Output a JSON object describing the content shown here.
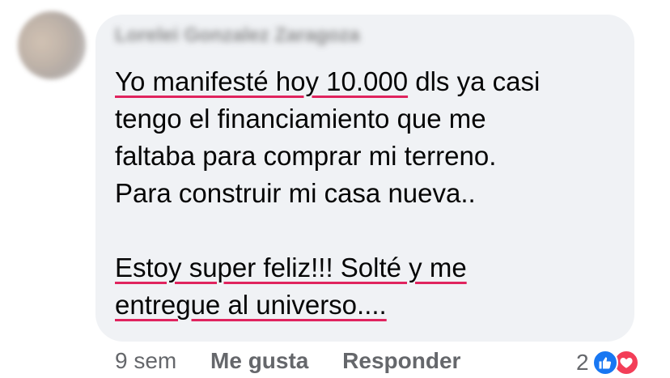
{
  "comment": {
    "author": "Lorelei Gonzalez Zaragoza",
    "lines": [
      {
        "before": "",
        "underlined": "Yo manifesté hoy 10.000",
        "after": " dls ya casi"
      },
      {
        "text": "tengo el financiamiento que me"
      },
      {
        "text": "faltaba para comprar mi terreno."
      },
      {
        "text": "Para construir mi casa nueva.."
      },
      {
        "text": ""
      },
      {
        "underlined": "Estoy super feliz!!! Solté y me"
      },
      {
        "underlined": "entregue al universo...."
      }
    ]
  },
  "footer": {
    "time": "9 sem",
    "like_label": "Me gusta",
    "reply_label": "Responder"
  },
  "reactions": {
    "count": "2",
    "icons": [
      "thumbs-up-icon",
      "heart-icon"
    ],
    "like_color": "#1877f2",
    "love_color": "#f33e58"
  },
  "colors": {
    "bubble": "#f0f2f5",
    "text": "#050505",
    "meta": "#65676b",
    "underline": "#e0245e"
  }
}
